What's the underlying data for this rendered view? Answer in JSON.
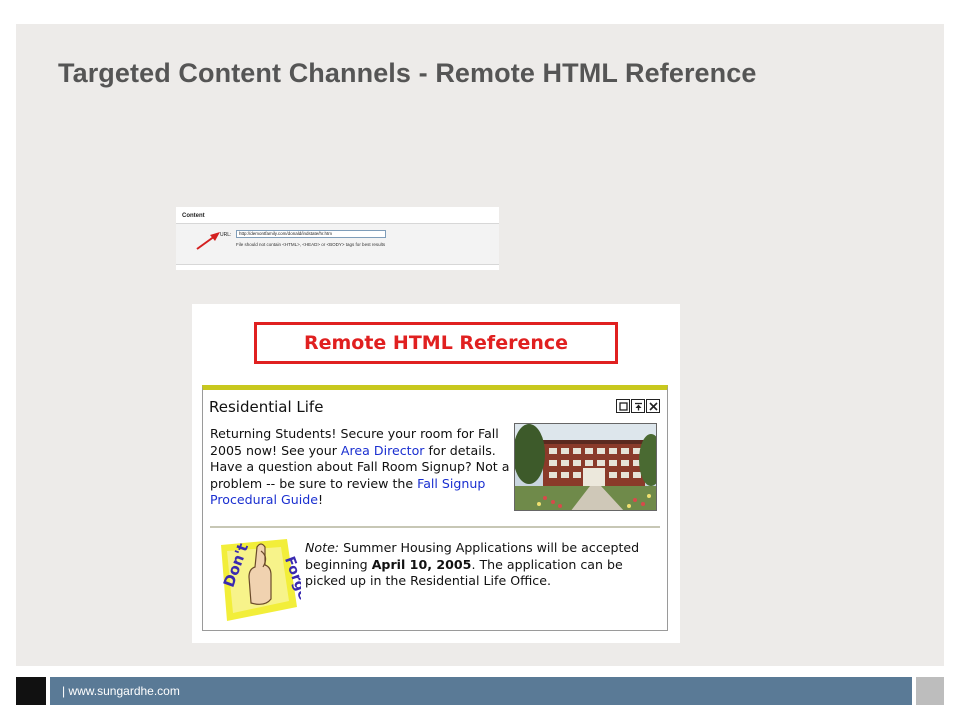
{
  "slide": {
    "title": "Targeted Content Channels - Remote HTML Reference"
  },
  "content_config": {
    "section_title": "Content",
    "url_label": "URL:",
    "url_value": "http://demontfamily.com/donald/indstate/hr.htm",
    "hint": "File should not contain <HTML>, <HEAD> or <BODY> tags for best results"
  },
  "portal": {
    "banner": "Remote HTML Reference",
    "channel": {
      "title": "Residential Life",
      "controls": [
        "edit-icon",
        "maximize-icon",
        "close-icon"
      ],
      "paragraph": {
        "p1": "Returning Students! Secure your room for Fall 2005 now! See your ",
        "link1": "Area Director",
        "p2": " for details. Have a question about Fall Room Signup? Not a problem -- be sure to review the ",
        "link2": "Fall Signup Procedural Guide",
        "p3": "!"
      },
      "note": {
        "label": "Note:",
        "t1": " Summer Housing Applications will be accepted beginning ",
        "date": "April 10, 2005",
        "t2": ". The application can be picked up in the Residential Life Office."
      },
      "sticker": {
        "word1": "Don't",
        "word2": "Forget"
      }
    }
  },
  "footer": {
    "text": "| www.sungardhe.com"
  },
  "colors": {
    "title": "#555555",
    "banner_red": "#e02020",
    "channel_accent": "#c8c81e",
    "link": "#1a2fd0",
    "footer_bar": "#5a7a96"
  }
}
